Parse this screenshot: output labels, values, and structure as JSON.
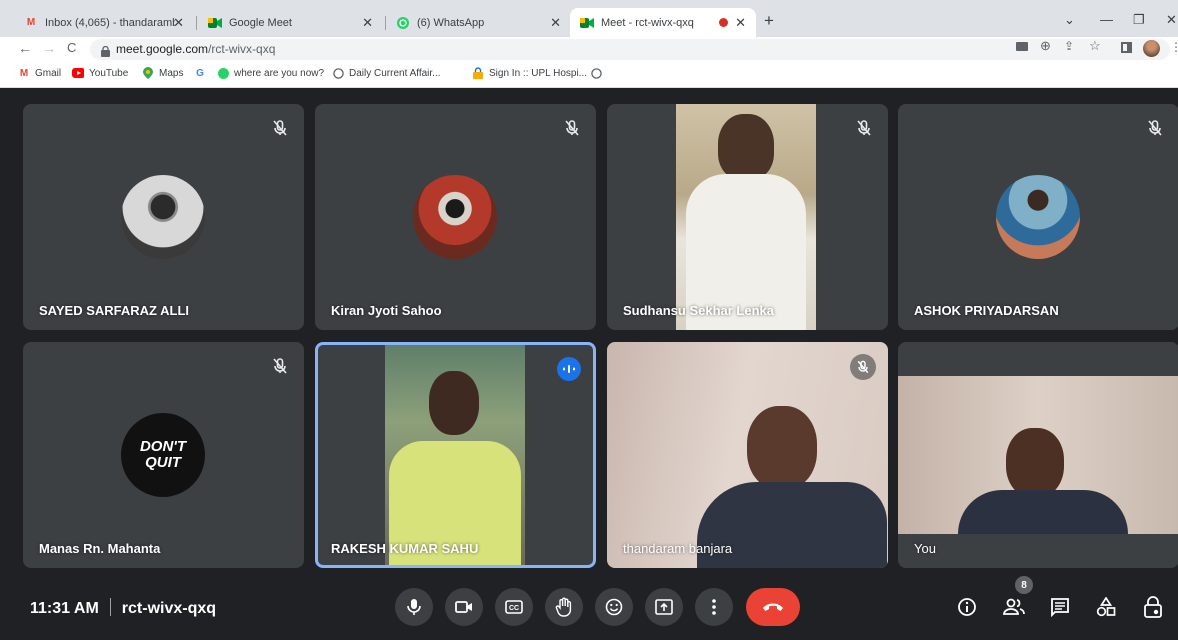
{
  "browser": {
    "tabs": [
      {
        "title": "Inbox (4,065) - thandarambanjara",
        "favicon": "gmail-icon",
        "active": false
      },
      {
        "title": "Google Meet",
        "favicon": "meet-icon",
        "active": false
      },
      {
        "title": "(6) WhatsApp",
        "favicon": "whatsapp-icon",
        "active": false
      },
      {
        "title": "Meet - rct-wivx-qxq",
        "favicon": "meet-icon",
        "active": true
      }
    ],
    "new_tab_label": "+",
    "url_host": "meet.google.com",
    "url_path": "/rct-wivx-qxq",
    "bookmarks": [
      {
        "label": "Gmail",
        "icon": "gmail-icon"
      },
      {
        "label": "YouTube",
        "icon": "youtube-icon"
      },
      {
        "label": "Maps",
        "icon": "maps-icon"
      },
      {
        "label": "",
        "icon": "google-icon"
      },
      {
        "label": "where are you now?",
        "icon": "whatsapp-icon"
      },
      {
        "label": "Daily Current Affair...",
        "icon": "globe-icon"
      },
      {
        "label": "Sign In :: UPL Hospi...",
        "icon": "lock-icon"
      },
      {
        "label": "",
        "icon": "globe-icon"
      }
    ]
  },
  "participants": [
    {
      "name": "SAYED SARFARAZ ALLI",
      "muted": true,
      "display": "avatar"
    },
    {
      "name": "Kiran Jyoti Sahoo",
      "muted": true,
      "display": "avatar"
    },
    {
      "name": "Sudhansu Sekhar Lenka",
      "muted": true,
      "display": "video"
    },
    {
      "name": "ASHOK PRIYADARSAN",
      "muted": true,
      "display": "avatar"
    },
    {
      "name": "Manas Rn. Mahanta",
      "muted": true,
      "display": "avatar",
      "avatar_text": [
        "DON'T",
        "QUIT"
      ]
    },
    {
      "name": "RAKESH KUMAR SAHU",
      "muted": false,
      "speaking": true,
      "display": "video"
    },
    {
      "name": "thandaram banjara",
      "muted": true,
      "display": "video"
    },
    {
      "name": "You",
      "muted": false,
      "display": "video"
    }
  ],
  "meeting": {
    "time": "11:31 AM",
    "code": "rct-wivx-qxq",
    "participant_count": "8"
  },
  "colors": {
    "background": "#202124",
    "tile": "#3c4043",
    "active_speaker": "#8ab4f8",
    "end_call": "#ea4335"
  }
}
